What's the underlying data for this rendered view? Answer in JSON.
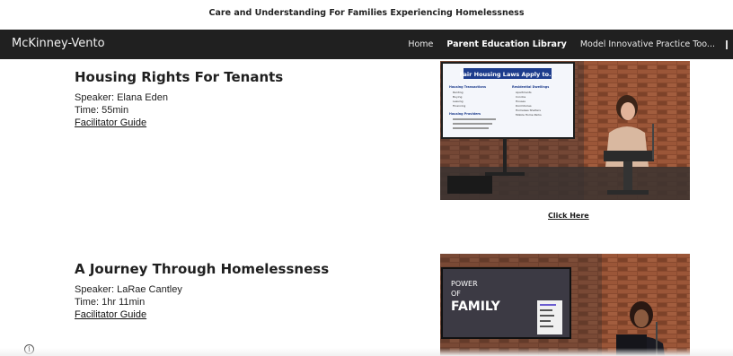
{
  "site": {
    "tagline": "Care and Understanding For Families Experiencing Homelessness",
    "brand": "McKinney-Vento"
  },
  "nav": {
    "links": [
      "Home",
      "Parent Education Library",
      "Model Innovative Practice Too..."
    ],
    "active_index": 1
  },
  "talks": [
    {
      "title": "Housing Rights For Tenants",
      "speaker": "Speaker: Elana Eden",
      "time": "Time: 55min",
      "guide_link": "Facilitator Guide",
      "video": {
        "slide_heading": "Fair Housing Laws Apply to...",
        "col1_head": "Housing Transactions",
        "col1_items": [
          "Renting",
          "Buying",
          "Leasing",
          "Financing"
        ],
        "col1_head2": "Housing Providers",
        "col2_head": "Residential Dwellings",
        "col2_items": [
          "Apartments",
          "Condos",
          "Houses",
          "Dormitories",
          "Homeless Shelters",
          "Mobile Home Parks"
        ]
      },
      "action_link": "Click Here"
    },
    {
      "title": "A Journey Through Homelessness",
      "speaker": "Speaker: LaRae Cantley",
      "time": "Time: 1hr 11min",
      "guide_link": "Facilitator Guide",
      "video": {
        "screen_line1": "POWER",
        "screen_line2": "OF",
        "screen_line3": "FAMILY"
      }
    }
  ],
  "colors": {
    "navbar": "#202020",
    "slide_blue": "#1d3c8c",
    "brick": "#8a4a2f"
  },
  "icons": {
    "info": "info-circle-icon"
  }
}
